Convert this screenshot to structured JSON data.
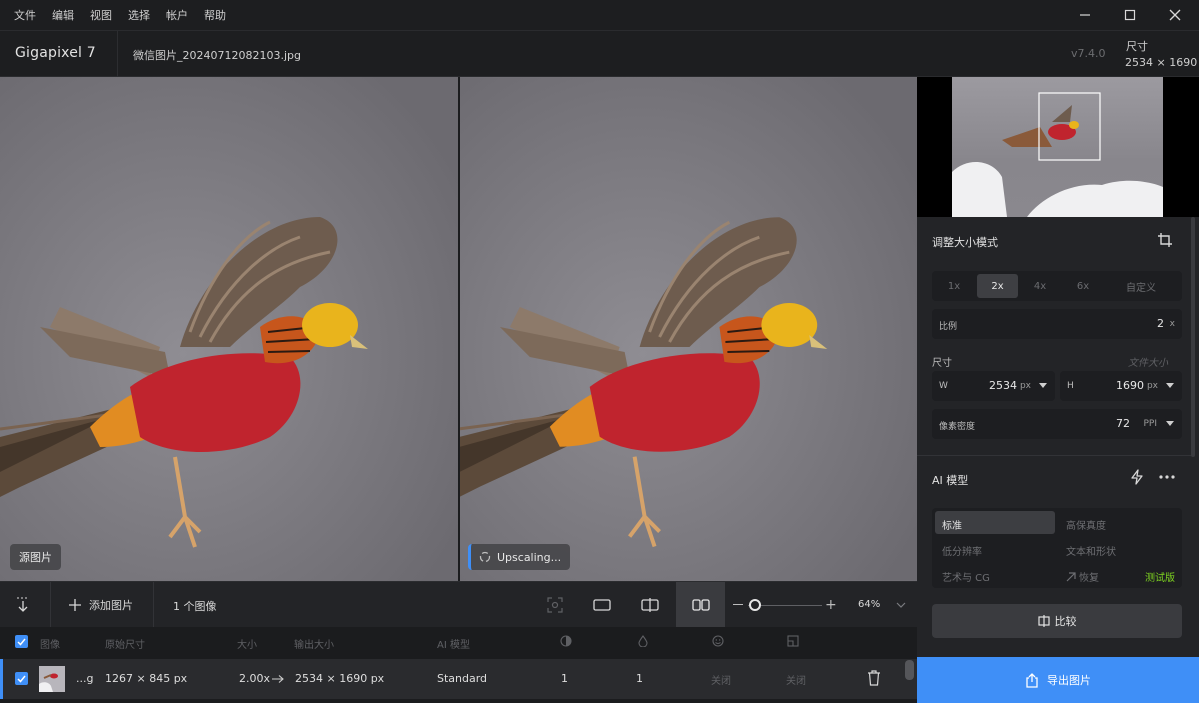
{
  "menu": [
    "文件",
    "编辑",
    "视图",
    "选择",
    "帐户",
    "帮助"
  ],
  "header": {
    "app_title": "Gigapixel 7",
    "file_name": "微信图片_20240712082103.jpg",
    "version": "v7.4.0",
    "size_label": "尺寸",
    "size_value": "2534 × 1690"
  },
  "panes": {
    "left_badge": "源图片",
    "right_badge": "Upscaling..."
  },
  "resize": {
    "title": "调整大小模式",
    "scale_options": [
      "1x",
      "2x",
      "4x",
      "6x",
      "自定义"
    ],
    "active_scale": "2x",
    "ratio_label": "比例",
    "ratio_value": "2",
    "ratio_unit": "x",
    "dimension_label": "尺寸",
    "file_size_link": "文件大小",
    "width_label": "W",
    "width_value": "2534",
    "width_unit": "px",
    "height_label": "H",
    "height_value": "1690",
    "height_unit": "px",
    "density_label": "像素密度",
    "density_value": "72",
    "density_unit": "PPI"
  },
  "ai_model": {
    "title": "AI 模型",
    "options": [
      "标准",
      "高保真度",
      "低分辨率",
      "文本和形状",
      "艺术与 CG",
      "恢复"
    ],
    "active": "标准",
    "beta_badge": "测试版"
  },
  "compare_label": "比较",
  "export_label": "导出图片",
  "toolbar": {
    "add_image": "添加图片",
    "image_count": "1 个图像",
    "zoom": "64%"
  },
  "table": {
    "columns": [
      "图像",
      "原始尺寸",
      "大小",
      "输出大小",
      "AI 模型"
    ],
    "row": {
      "name": "...g",
      "original": "1267 × 845 px",
      "scale": "2.00x",
      "output": "2534 × 1690 px",
      "model": "Standard",
      "col_a": "1",
      "col_b": "1",
      "col_c": "关闭",
      "col_d": "关闭"
    }
  },
  "colors": {
    "accent": "#3f8ff7",
    "beta": "#7ed321",
    "background": "#1b1c1e",
    "panel": "#232427"
  }
}
